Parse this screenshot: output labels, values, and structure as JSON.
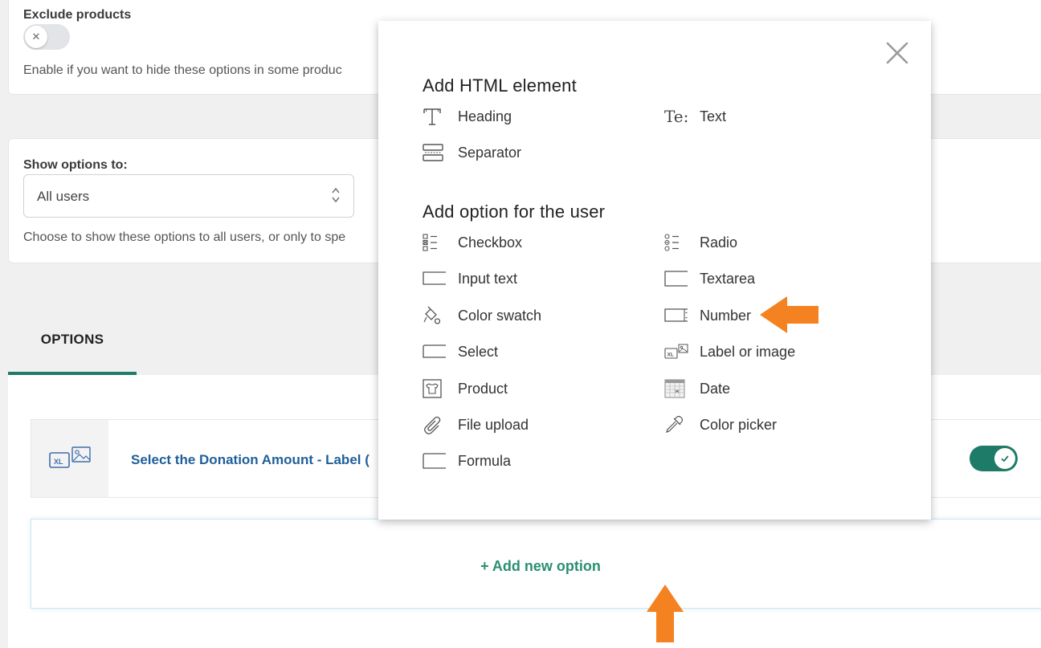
{
  "exclude": {
    "label": "Exclude products",
    "toggle_symbol": "✕",
    "help": "Enable if you want to hide these options in some produc"
  },
  "show_options": {
    "label": "Show options to:",
    "selected": "All users",
    "help": "Choose to show these options to all users, or only to spe"
  },
  "tabs": {
    "options": "OPTIONS"
  },
  "option_row": {
    "title": "Select the Donation Amount - Label (",
    "enabled": true
  },
  "add_option": {
    "label": "+ Add new option"
  },
  "modal": {
    "section_html": "Add HTML element",
    "html_items": [
      {
        "label": "Heading",
        "icon": "heading-icon"
      },
      {
        "label": "Text",
        "icon": "text-icon"
      },
      {
        "label": "Separator",
        "icon": "separator-icon"
      }
    ],
    "text_icon_glyph": "Te:",
    "section_user": "Add option for the user",
    "user_items": [
      {
        "label": "Checkbox",
        "icon": "checkbox-icon"
      },
      {
        "label": "Radio",
        "icon": "radio-icon"
      },
      {
        "label": "Input text",
        "icon": "input-text-icon"
      },
      {
        "label": "Textarea",
        "icon": "textarea-icon"
      },
      {
        "label": "Color swatch",
        "icon": "color-swatch-icon"
      },
      {
        "label": "Number",
        "icon": "number-icon"
      },
      {
        "label": "Select",
        "icon": "select-icon"
      },
      {
        "label": "Label or image",
        "icon": "label-image-icon"
      },
      {
        "label": "Product",
        "icon": "product-icon"
      },
      {
        "label": "Date",
        "icon": "date-icon"
      },
      {
        "label": "File upload",
        "icon": "file-upload-icon"
      },
      {
        "label": "Color picker",
        "icon": "color-picker-icon"
      },
      {
        "label": "Formula",
        "icon": "formula-icon"
      }
    ]
  },
  "colors": {
    "accent_green": "#1e7b67",
    "link_blue": "#1f5f99",
    "annotation_orange": "#f58220"
  }
}
